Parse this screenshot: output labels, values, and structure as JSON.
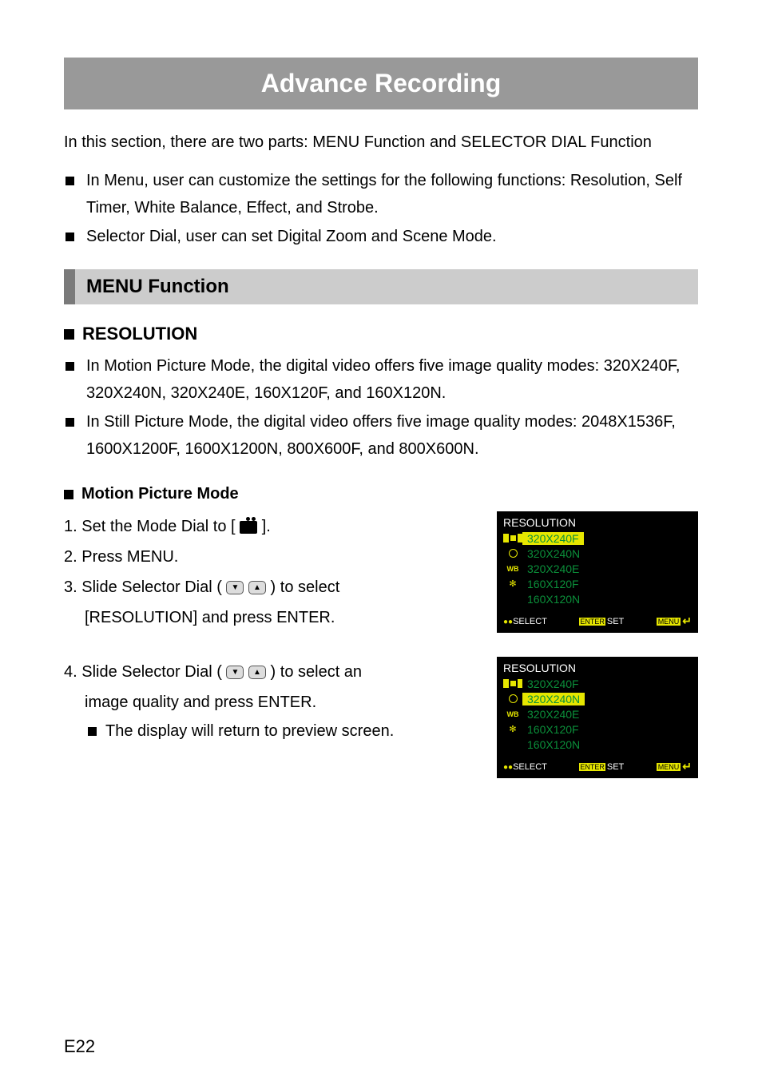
{
  "mainTitle": "Advance Recording",
  "introText": "In this section, there are two parts: MENU Function and SELECTOR DIAL Function",
  "introBullets": [
    "In Menu, user can customize the settings for the following functions: Resolution, Self Timer, White Balance, Effect, and Strobe.",
    "Selector Dial, user can set Digital Zoom and Scene Mode."
  ],
  "menuFunctionHeading": "MENU Function",
  "resolutionHeading": "RESOLUTION",
  "resolutionBullets": [
    "In Motion Picture Mode, the digital video offers five image quality modes: 320X240F, 320X240N, 320X240E, 160X120F, and 160X120N.",
    "In Still Picture Mode, the digital video offers five image quality modes: 2048X1536F, 1600X1200F, 1600X1200N, 800X600F, and 800X600N."
  ],
  "motionPictureHeading": "Motion Picture Mode",
  "steps1": {
    "s1a": "1. Set the Mode Dial to [ ",
    "s1b": " ].",
    "s2": "2. Press MENU.",
    "s3a": "3. Slide Selector Dial ( ",
    "s3b": " ) to select",
    "s3c": "[RESOLUTION] and press ENTER."
  },
  "steps2": {
    "s4a": "4. Slide Selector Dial ( ",
    "s4b": " ) to select an",
    "s4c": "image quality and press ENTER.",
    "s4d": "The display will return to preview screen."
  },
  "ui1": {
    "title": "RESOLUTION",
    "rows": [
      {
        "label": "320X240F",
        "activeLabel": true,
        "activeIcon": true
      },
      {
        "label": "320X240N",
        "activeLabel": false,
        "activeIcon": false
      },
      {
        "label": "320X240E",
        "activeLabel": false,
        "activeIcon": false
      },
      {
        "label": "160X120F",
        "activeLabel": false,
        "activeIcon": false
      },
      {
        "label": "160X120N",
        "activeLabel": false,
        "activeIcon": false
      }
    ],
    "footer": {
      "selectPrefix": "●●",
      "select": "SELECT",
      "setPrefix": "ENTER",
      "set": "SET",
      "menu": "MENU",
      "arrow": "↵"
    }
  },
  "ui2": {
    "title": "RESOLUTION",
    "rows": [
      {
        "label": "320X240F",
        "activeLabel": false,
        "activeIcon": true
      },
      {
        "label": "320X240N",
        "activeLabel": true,
        "activeIcon": false
      },
      {
        "label": "320X240E",
        "activeLabel": false,
        "activeIcon": false
      },
      {
        "label": "160X120F",
        "activeLabel": false,
        "activeIcon": false
      },
      {
        "label": "160X120N",
        "activeLabel": false,
        "activeIcon": false
      }
    ],
    "footer": {
      "selectPrefix": "●●",
      "select": "SELECT",
      "setPrefix": "ENTER",
      "set": "SET",
      "menu": "MENU",
      "arrow": "↵"
    }
  },
  "iconWB": "WB",
  "pageNumber": "E22"
}
